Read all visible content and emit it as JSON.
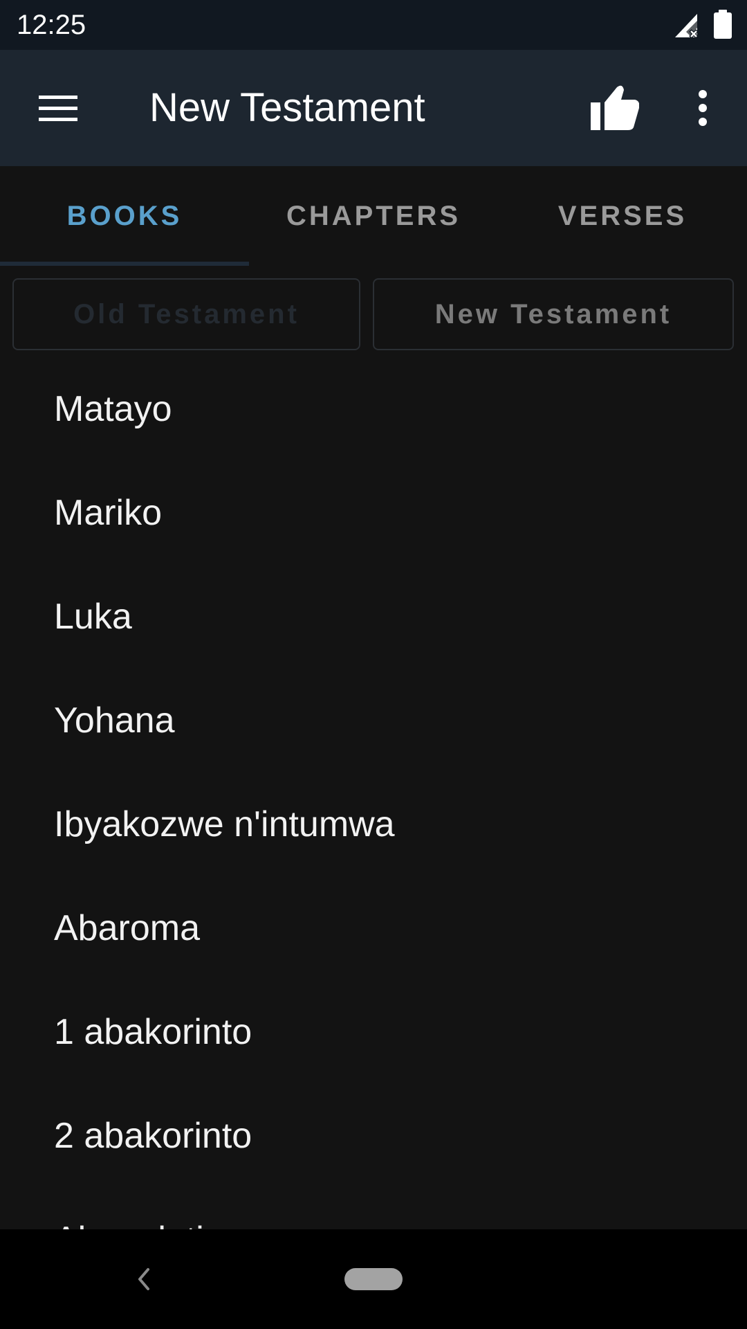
{
  "status_bar": {
    "time": "12:25",
    "icons": [
      "signal-no-data-icon",
      "battery-full-icon"
    ]
  },
  "app_bar": {
    "title": "New Testament",
    "icons": [
      "menu-icon",
      "thumbs-up-icon",
      "more-vert-icon"
    ]
  },
  "tabs": [
    {
      "label": "BOOKS",
      "active": true
    },
    {
      "label": "CHAPTERS",
      "active": false
    },
    {
      "label": "VERSES",
      "active": false
    }
  ],
  "testament_toggle": {
    "old_label": "Old Testament",
    "new_label": "New Testament",
    "selected": "New Testament"
  },
  "books": [
    "Matayo",
    "Mariko",
    "Luka",
    "Yohana",
    "Ibyakozwe n'intumwa",
    "Abaroma",
    "1 abakorinto",
    "2 abakorinto",
    "Abagalatiya"
  ],
  "nav_bar": {
    "icons": [
      "back-icon",
      "home-pill"
    ]
  },
  "colors": {
    "status_bar_bg": "#111821",
    "app_bar_bg": "#1d2630",
    "background": "#131313",
    "tab_active": "#5aa0cc",
    "tab_inactive": "#9a9a9a"
  }
}
